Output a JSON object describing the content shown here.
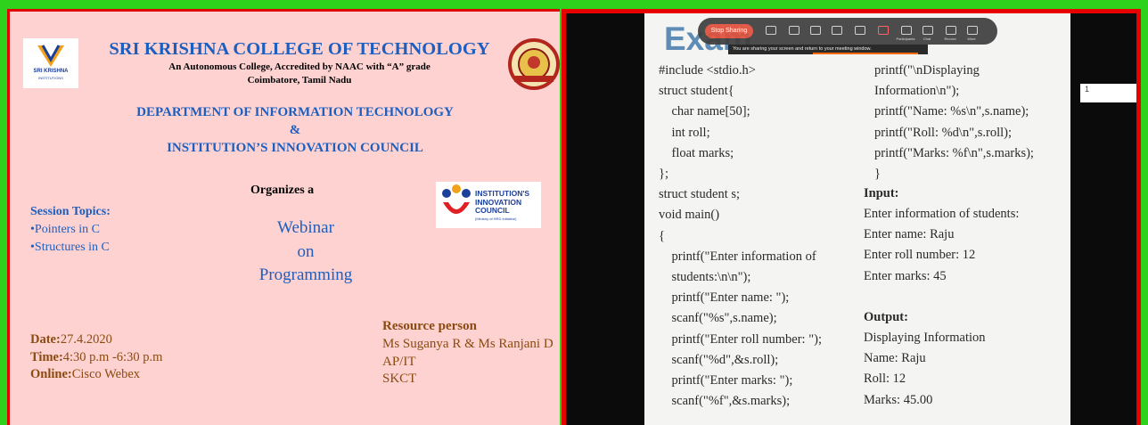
{
  "poster": {
    "college_name": "SRI KRISHNA COLLEGE OF TECHNOLOGY",
    "subtitle_line1": "An Autonomous College, Accredited by NAAC with “A” grade",
    "subtitle_line2": "Coimbatore, Tamil Nadu",
    "logo_left_text1": "SRI KRISHNA",
    "logo_left_text2": "INSTITUTIONS",
    "department_line1": "DEPARTMENT OF INFORMATION TECHNOLOGY",
    "department_line2": "&",
    "department_line3": "INSTITUTION’S INNOVATION COUNCIL",
    "organizes": "Organizes a",
    "iic_logo_line1": "INSTITUTION'S",
    "iic_logo_line2": "INNOVATION",
    "iic_logo_line3": "COUNCIL",
    "iic_logo_line4": "(Ministry of HRD Initiative)",
    "session_topics_heading": "Session Topics:",
    "topics": [
      "•Pointers in C",
      "•Structures in C"
    ],
    "webinar_line1": "Webinar",
    "webinar_line2": "on",
    "webinar_line3": "Programming",
    "resource_heading": "Resource person",
    "resource_names": "Ms Suganya R & Ms Ranjani D",
    "resource_dept": "AP/IT",
    "resource_inst": "SKCT",
    "date_label": "Date:",
    "date_value": "27.4.2020",
    "time_label": "Time:",
    "time_value": "4:30 p.m -6:30 p.m",
    "online_label": "Online:",
    "online_value": "Cisco Webex"
  },
  "video": {
    "slide_title": "Exam",
    "toolbar_stop": "Stop Sharing",
    "toolbar_labels": [
      "",
      "",
      "",
      "",
      "",
      "",
      "Participants",
      "Chat",
      "Record",
      "More"
    ],
    "banner_text": "You are sharing your screen and return to your meeting window.",
    "side_label": "1",
    "code_left": [
      "#include <stdio.h>",
      "struct student{",
      "    char name[50];",
      "    int roll;",
      "    float marks;",
      "};",
      "struct student s;",
      "void main()",
      "{",
      "    printf(\"Enter information of",
      "    students:\\n\\n\");",
      "    printf(\"Enter name: \");",
      "    scanf(\"%s\",s.name);",
      "    printf(\"Enter roll number: \");",
      "    scanf(\"%d\",&s.roll);",
      "    printf(\"Enter marks: \");",
      "    scanf(\"%f\",&s.marks);"
    ],
    "code_right_top": [
      "printf(\"\\nDisplaying",
      "Information\\n\");",
      "printf(\"Name: %s\\n\",s.name);",
      "printf(\"Roll: %d\\n\",s.roll);",
      "printf(\"Marks: %f\\n\",s.marks);",
      "}"
    ],
    "input_heading": "Input:",
    "input_lines": [
      "Enter information of students:",
      "Enter name: Raju",
      "Enter roll number: 12",
      "Enter marks: 45"
    ],
    "output_heading": "Output:",
    "output_lines": [
      "Displaying Information",
      "Name: Raju",
      "Roll: 12",
      "Marks: 45.00"
    ]
  },
  "colors": {
    "border_green": "#2ed11b",
    "border_red": "#e80000",
    "poster_bg": "#ffd2d2",
    "heading_blue": "#1c5fbf",
    "brown_text": "#8a4a10",
    "slide_bg": "#f4f4f2"
  }
}
